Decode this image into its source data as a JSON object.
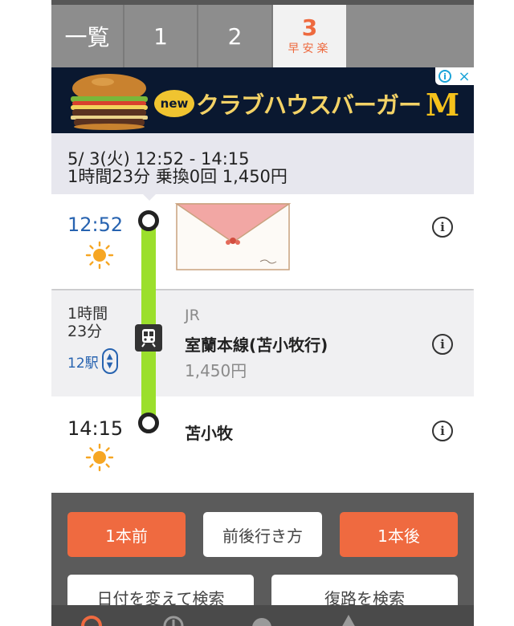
{
  "tabs": [
    {
      "label": "一覧"
    },
    {
      "label": "1"
    },
    {
      "label": "2"
    },
    {
      "label": "3",
      "sub": "早安楽",
      "active": true
    }
  ],
  "ad": {
    "badge": "new",
    "text": "クラブハウスバーガー",
    "logo": "M",
    "info_icon": "i",
    "close_icon": "×"
  },
  "summary": {
    "date_time": "5/ 3(火) 12:52 - 14:15",
    "details": "1時間23分 乗換0回 1,450円"
  },
  "route": {
    "departure": {
      "time": "12:52",
      "weather": "sun-icon"
    },
    "segment": {
      "duration_line1": "1時間",
      "duration_line2": "23分",
      "stations": "12駅",
      "operator": "JR",
      "line": "室蘭本線(苫小牧行)",
      "fare": "1,450円"
    },
    "arrival": {
      "time": "14:15",
      "station": "苫小牧",
      "weather": "sun-icon"
    }
  },
  "buttons": {
    "prev": "1本前",
    "around": "前後行き方",
    "next": "1本後",
    "change_date": "日付を変えて検索",
    "return_route": "復路を検索"
  },
  "colors": {
    "accent": "#ef6a40",
    "track": "#9bdf2c",
    "time_blue": "#2763b0"
  }
}
